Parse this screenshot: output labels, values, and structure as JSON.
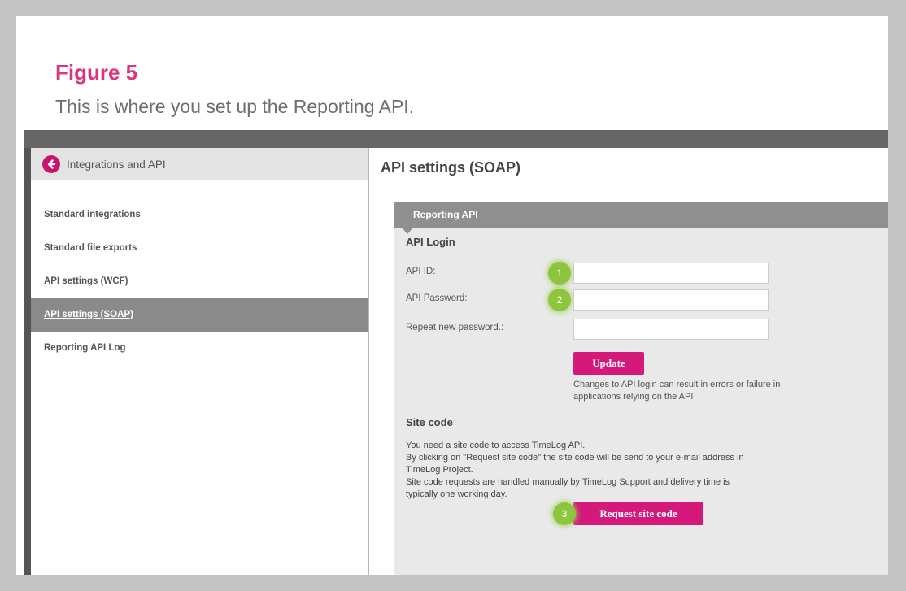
{
  "figure": {
    "title": "Figure 5",
    "caption": "This is where you set up the Reporting API."
  },
  "sidebar": {
    "header_label": "Integrations and API",
    "back_icon": "arrow-left-circle-icon",
    "items": [
      {
        "label": "Standard integrations",
        "active": false
      },
      {
        "label": "Standard file exports",
        "active": false
      },
      {
        "label": "API settings (WCF)",
        "active": false
      },
      {
        "label": "API settings (SOAP)",
        "active": true
      },
      {
        "label": "Reporting API Log",
        "active": false
      }
    ]
  },
  "main": {
    "page_title": "API settings (SOAP)",
    "panel": {
      "header": "Reporting API",
      "api_login": {
        "title": "API Login",
        "fields": [
          {
            "label": "API ID:",
            "value": "",
            "badge": "1"
          },
          {
            "label": "API Password:",
            "value": "",
            "badge": "2"
          },
          {
            "label": "Repeat new password.:",
            "value": ""
          }
        ],
        "update_label": "Update",
        "note_line1": "Changes to API login can result in errors or failure in",
        "note_line2": "applications relying on the API"
      },
      "site_code": {
        "title": "Site code",
        "lines": [
          "You need a site code to access TimeLog API.",
          "By clicking on \"Request site code\" the site code will be send to your e-mail address in",
          "TimeLog Project.",
          "Site code requests are handled manually by TimeLog Support and delivery time is",
          "typically one working day."
        ],
        "request_label": "Request site code",
        "request_badge": "3"
      }
    }
  },
  "colors": {
    "accent": "#d4197a",
    "figure_title": "#e0337f",
    "badge": "#8dc53e",
    "panel_header": "#8f8f8f",
    "active_nav": "#8a8a8a"
  }
}
